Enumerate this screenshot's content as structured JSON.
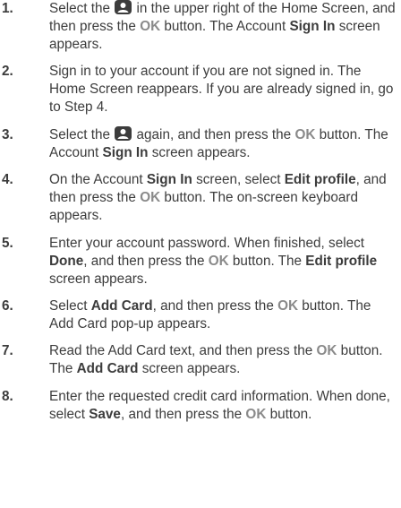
{
  "steps": [
    {
      "number": "1.",
      "parts": [
        {
          "t": "Select the "
        },
        {
          "icon": "account-icon"
        },
        {
          "t": " in the upper right of the Home Screen, and then press the "
        },
        {
          "ok": "OK"
        },
        {
          "t": " button. The Account "
        },
        {
          "b": "Sign In"
        },
        {
          "t": " screen appears."
        }
      ]
    },
    {
      "number": "2.",
      "parts": [
        {
          "t": "Sign in to your account if you are not signed in. The Home Screen reappears. If you are already signed in, go to Step 4."
        }
      ]
    },
    {
      "number": "3.",
      "parts": [
        {
          "t": "Select the "
        },
        {
          "icon": "account-icon"
        },
        {
          "t": " again, and then press the "
        },
        {
          "ok": "OK"
        },
        {
          "t": " button. The Account "
        },
        {
          "b": "Sign In"
        },
        {
          "t": " screen appears."
        }
      ]
    },
    {
      "number": "4.",
      "parts": [
        {
          "t": "On the Account "
        },
        {
          "b": "Sign In"
        },
        {
          "t": " screen, select "
        },
        {
          "b": "Edit profile"
        },
        {
          "t": ", and then press the "
        },
        {
          "ok": "OK"
        },
        {
          "t": " button. The on-screen keyboard appears."
        }
      ]
    },
    {
      "number": "5.",
      "parts": [
        {
          "t": "Enter your account password. When finished, select "
        },
        {
          "b": "Done"
        },
        {
          "t": ", and then press the "
        },
        {
          "ok": "OK"
        },
        {
          "t": " button. The "
        },
        {
          "b": "Edit profile"
        },
        {
          "t": " screen appears."
        }
      ]
    },
    {
      "number": "6.",
      "parts": [
        {
          "t": "Select "
        },
        {
          "b": "Add Card"
        },
        {
          "t": ", and then press the "
        },
        {
          "ok": "OK"
        },
        {
          "t": " button. The Add Card pop-up appears."
        }
      ]
    },
    {
      "number": "7.",
      "parts": [
        {
          "t": "Read the Add Card text, and then press the "
        },
        {
          "ok": "OK"
        },
        {
          "t": " button. The "
        },
        {
          "b": "Add Card"
        },
        {
          "t": " screen appears."
        }
      ]
    },
    {
      "number": "8.",
      "parts": [
        {
          "t": "Enter the requested credit card information. When done, select "
        },
        {
          "b": "Save"
        },
        {
          "t": ", and then press the "
        },
        {
          "ok": "OK"
        },
        {
          "t": " button."
        }
      ]
    }
  ]
}
